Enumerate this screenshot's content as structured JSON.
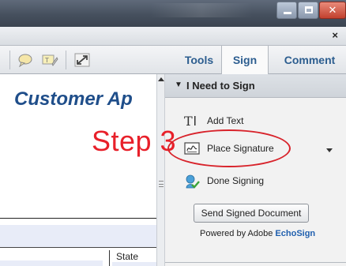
{
  "window": {
    "buttons": {
      "minimize": "–",
      "maximize": "□",
      "close": "✕"
    }
  },
  "docbar": {
    "close_glyph": "×"
  },
  "toolbar": {
    "icons": [
      "comment-bubble-icon",
      "highlight-pen-icon",
      "expand-icon"
    ],
    "tabs": [
      {
        "label": "Tools",
        "active": false
      },
      {
        "label": "Sign",
        "active": true
      },
      {
        "label": "Comment",
        "active": false
      }
    ]
  },
  "document": {
    "title_partial": "Customer Ap",
    "state_label": "State"
  },
  "overlay": {
    "step_text": "Step 3",
    "highlight_color": "#d8232b"
  },
  "panel": {
    "header": "I Need to Sign",
    "items": [
      {
        "label": "Add Text",
        "icon": "text-tool-icon"
      },
      {
        "label": "Place Signature",
        "icon": "signature-icon"
      },
      {
        "label": "Done Signing",
        "icon": "done-signing-icon"
      }
    ],
    "send_button": "Send Signed Document",
    "powered_prefix": "Powered by Adobe",
    "powered_brand": "EchoSign"
  },
  "colors": {
    "tab_text": "#2c5d8f",
    "brand_link": "#1f5fae",
    "doc_title": "#1f4e8a",
    "step_red": "#e8202a"
  }
}
